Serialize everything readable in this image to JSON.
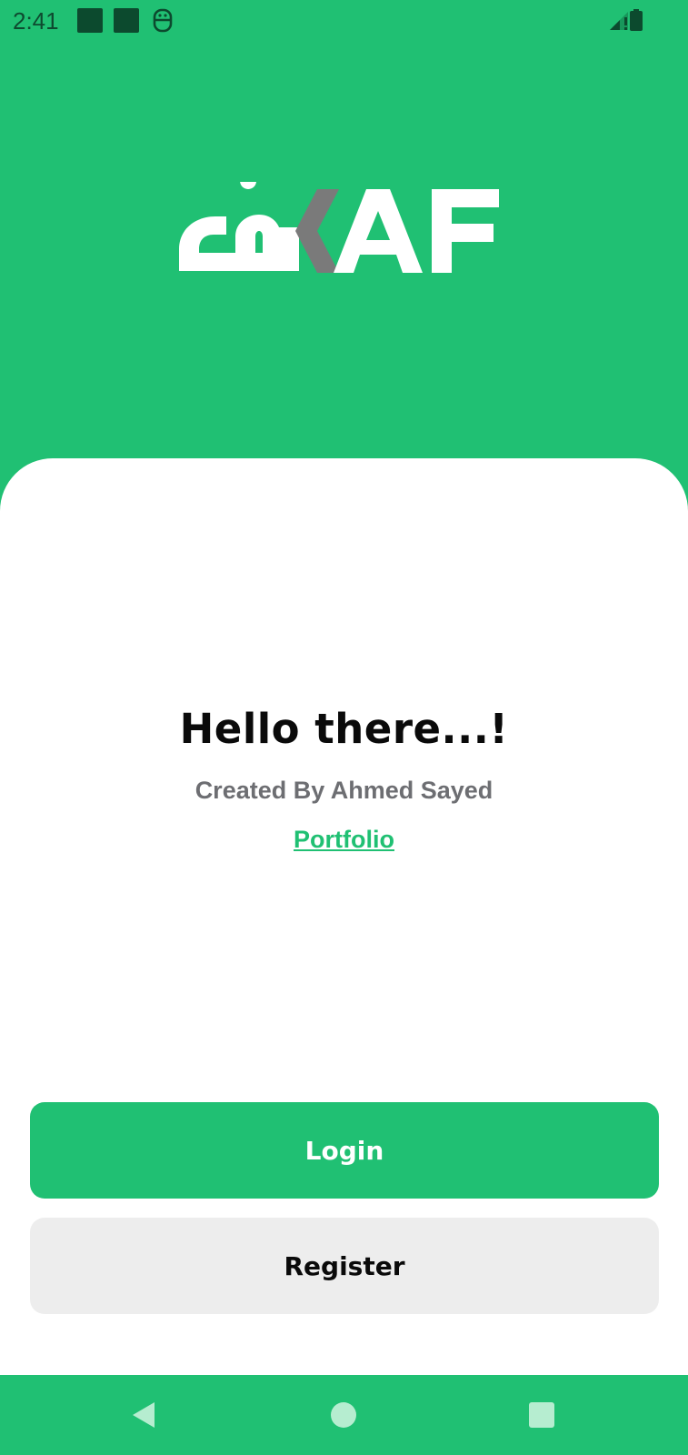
{
  "status_bar": {
    "time": "2:41",
    "icons": [
      "notification-square-icon",
      "notification-square-icon",
      "sim-face-icon",
      "signal-icon",
      "battery-icon"
    ]
  },
  "logo": {
    "latin_text": "AF",
    "arabic_text": "كاف",
    "colors": {
      "primary": "#FFFFFF",
      "accent": "#7A7A7A"
    }
  },
  "welcome": {
    "title": "Hello there...!",
    "subtitle": "Created By Ahmed Sayed",
    "link_label": "Portfolio"
  },
  "actions": {
    "login_label": "Login",
    "register_label": "Register"
  },
  "nav_bar": {
    "buttons": [
      "back-icon",
      "home-icon",
      "recents-icon"
    ]
  },
  "colors": {
    "brand_green": "#20C073",
    "card_bg": "#FFFFFF",
    "secondary_button": "#EDEDED",
    "text_dark": "#0A0A0A",
    "text_muted": "#6D6E72"
  }
}
